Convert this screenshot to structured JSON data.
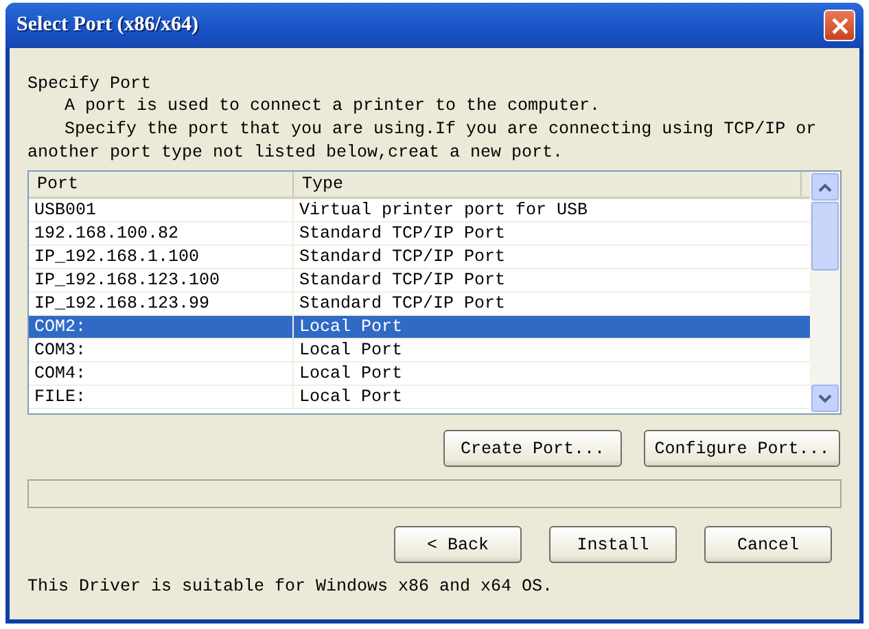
{
  "window": {
    "title": "Select Port (x86/x64)"
  },
  "intro": {
    "heading": "Specify Port",
    "lines": [
      "A port is used to connect a printer to the computer.",
      "Specify the port that you are using.If you are connecting using TCP/IP or another port type not listed below,creat a new port."
    ]
  },
  "table": {
    "columns": [
      "Port",
      "Type"
    ],
    "rows": [
      {
        "port": "USB001",
        "type": "Virtual printer port for USB",
        "selected": false
      },
      {
        "port": "192.168.100.82",
        "type": "Standard TCP/IP Port",
        "selected": false
      },
      {
        "port": "IP_192.168.1.100",
        "type": "Standard TCP/IP Port",
        "selected": false
      },
      {
        "port": "IP_192.168.123.100",
        "type": "Standard TCP/IP Port",
        "selected": false
      },
      {
        "port": "IP_192.168.123.99",
        "type": "Standard TCP/IP Port",
        "selected": false
      },
      {
        "port": "COM2:",
        "type": "Local Port",
        "selected": true
      },
      {
        "port": "COM3:",
        "type": "Local Port",
        "selected": false
      },
      {
        "port": "COM4:",
        "type": "Local Port",
        "selected": false
      },
      {
        "port": "FILE:",
        "type": "Local Port",
        "selected": false
      }
    ]
  },
  "port_buttons": [
    "Create Port...",
    "Configure Port..."
  ],
  "nav_buttons": [
    "< Back",
    "Install",
    "Cancel"
  ],
  "footer": "This Driver is suitable for Windows x86 and x64 OS."
}
